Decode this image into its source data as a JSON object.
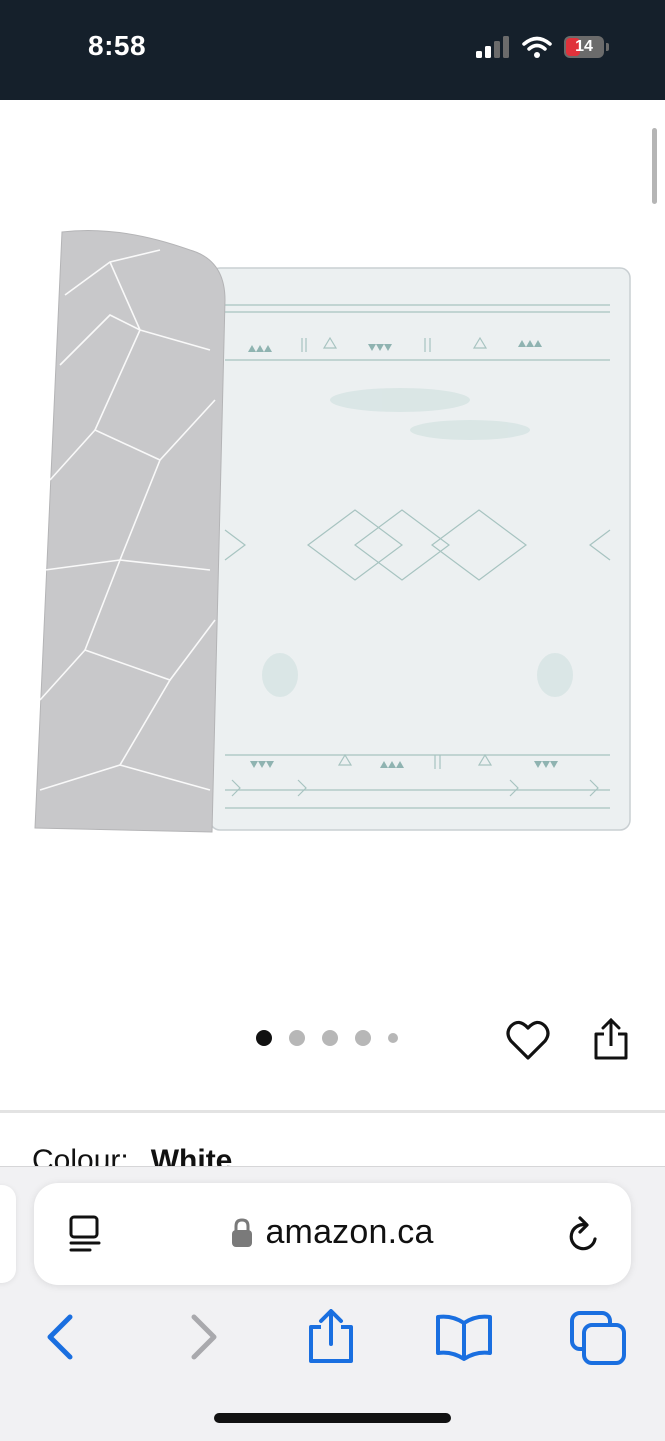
{
  "status_bar": {
    "time": "8:58",
    "battery_level": "14",
    "battery_color": "#e0323b",
    "icons": [
      "cellular-signal-icon",
      "wifi-icon",
      "battery-icon"
    ]
  },
  "product": {
    "image_count": 5,
    "active_image": 1,
    "actions": [
      "heart-icon",
      "share-icon"
    ],
    "colour_label": "Colour:",
    "colour_value": "White"
  },
  "browser": {
    "url": "amazon.ca",
    "accent_color": "#1a6fe0",
    "url_bar_icons": [
      "reader-icon",
      "lock-icon",
      "reload-icon"
    ],
    "toolbar": [
      "back-icon",
      "forward-icon",
      "share-icon",
      "bookmarks-icon",
      "tabs-icon"
    ]
  }
}
